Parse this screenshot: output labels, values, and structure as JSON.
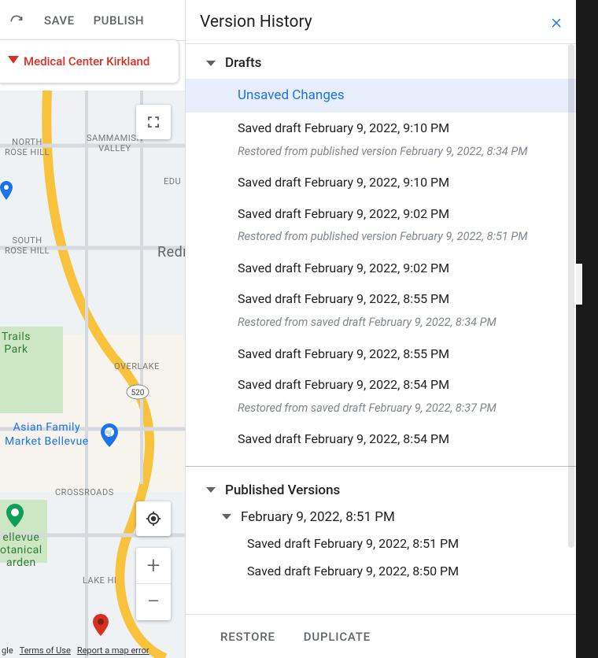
{
  "toolbar": {
    "save_label": "SAVE",
    "publish_label": "PUBLISH"
  },
  "card": {
    "title": "Medical Center Kirkland"
  },
  "panel": {
    "title": "Version History",
    "drafts_label": "Drafts",
    "published_label": "Published Versions",
    "restore_label": "RESTORE",
    "duplicate_label": "DUPLICATE"
  },
  "drafts": [
    {
      "label": "Unsaved Changes",
      "selected": true
    },
    {
      "label": "Saved draft February 9, 2022, 9:10 PM"
    },
    {
      "label": "Restored from published version February 9, 2022, 8:34 PM",
      "note": true
    },
    {
      "label": "Saved draft February 9, 2022, 9:10 PM"
    },
    {
      "label": "Saved draft February 9, 2022, 9:02 PM"
    },
    {
      "label": "Restored from published version February 9, 2022, 8:51 PM",
      "note": true
    },
    {
      "label": "Saved draft February 9, 2022, 9:02 PM"
    },
    {
      "label": "Saved draft February 9, 2022, 8:55 PM"
    },
    {
      "label": "Restored from saved draft February 9, 2022, 8:34 PM",
      "note": true
    },
    {
      "label": "Saved draft February 9, 2022, 8:55 PM"
    },
    {
      "label": "Saved draft February 9, 2022, 8:54 PM"
    },
    {
      "label": "Restored from saved draft February 9, 2022, 8:37 PM",
      "note": true
    },
    {
      "label": "Saved draft February 9, 2022, 8:54 PM"
    }
  ],
  "published": {
    "group_label": "February 9, 2022, 8:51 PM",
    "items": [
      "Saved draft February 9, 2022, 8:51 PM",
      "Saved draft February 9, 2022, 8:50 PM"
    ]
  },
  "map": {
    "labels": {
      "north_rose": "NORTH\nROSE HILL",
      "sammamish": "SAMMAMISH\nVALLEY",
      "edu": "EDU",
      "redmond": "Redn",
      "south_rose": "SOUTH\nROSE HILL",
      "trails_park": "Trails\nPark",
      "overlake": "OVERLAKE",
      "hwy": "520",
      "asian_market": "Asian Family\nMarket Bellevue",
      "crossroads": "CROSSROADS",
      "bellevue_garden": "ellevue\notanical\narden",
      "lake_hi": "LAKE HI"
    },
    "footer": {
      "credit": "gle",
      "terms": "Terms of Use",
      "report": "Report a map error"
    }
  }
}
